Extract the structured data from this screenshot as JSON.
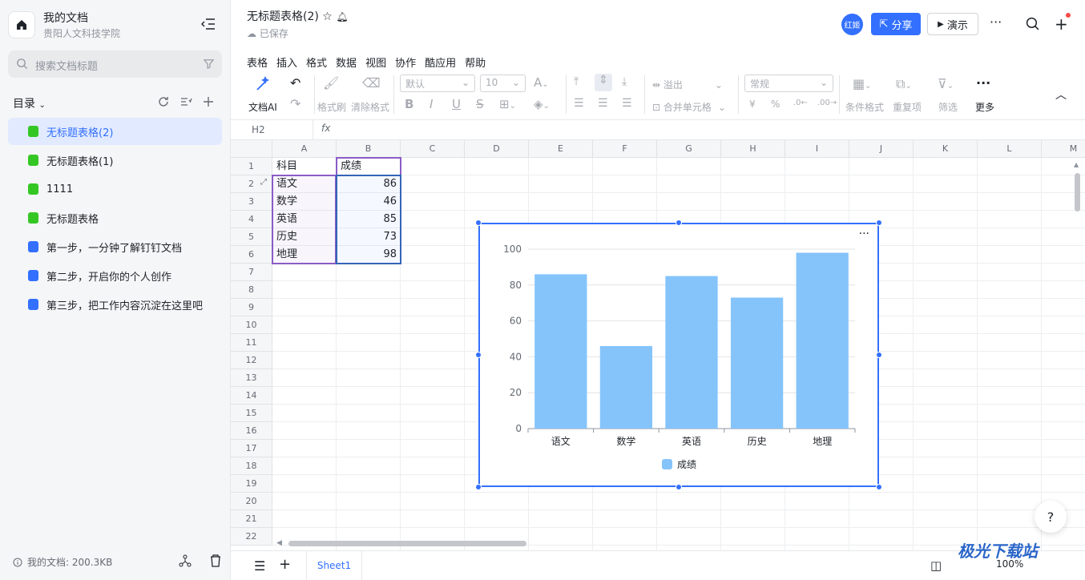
{
  "sidebar": {
    "workspace_name": "我的文档",
    "workspace_org": "贵阳人文科技学院",
    "search_placeholder": "搜索文档标题",
    "toc_label": "目录",
    "items": [
      {
        "label": "无标题表格(2)",
        "type": "sheet",
        "active": true
      },
      {
        "label": "无标题表格(1)",
        "type": "sheet",
        "active": false
      },
      {
        "label": "1111",
        "type": "sheet",
        "active": false
      },
      {
        "label": "无标题表格",
        "type": "sheet",
        "active": false
      },
      {
        "label": "第一步，一分钟了解钉钉文档",
        "type": "doc",
        "active": false
      },
      {
        "label": "第二步，开启你的个人创作",
        "type": "doc",
        "active": false
      },
      {
        "label": "第三步，把工作内容沉淀在这里吧",
        "type": "doc",
        "active": false
      }
    ],
    "footer": "我的文档: 200.3KB"
  },
  "header": {
    "title": "无标题表格(2)",
    "saved": "已保存",
    "avatar": "红姬",
    "share": "分享",
    "present": "演示"
  },
  "menu": [
    "表格",
    "插入",
    "格式",
    "数据",
    "视图",
    "协作",
    "酷应用",
    "帮助"
  ],
  "toolbar": {
    "ai": "文档AI",
    "format_painter": "格式刷",
    "clear_format": "清除格式",
    "font": "默认",
    "size": "10",
    "overflow": "溢出",
    "merge": "合并单元格",
    "numfmt": "常规",
    "currency": "¥",
    "percent": "%",
    "cond_format": "条件格式",
    "dup": "重复项",
    "filter": "筛选",
    "more": "更多"
  },
  "formula_bar": {
    "cell_ref": "H2",
    "fx": "fx"
  },
  "columns": [
    "A",
    "B",
    "C",
    "D",
    "E",
    "F",
    "G",
    "H",
    "I",
    "J",
    "K",
    "L",
    "M"
  ],
  "rows": [
    "1",
    "2",
    "3",
    "4",
    "5",
    "6",
    "7",
    "8",
    "9",
    "10",
    "11",
    "12",
    "13",
    "14",
    "15",
    "16",
    "17",
    "18",
    "19",
    "20",
    "21",
    "22"
  ],
  "cells": {
    "A1": "科目",
    "B1": "成绩",
    "A2": "语文",
    "B2": "86",
    "A3": "数学",
    "B3": "46",
    "A4": "英语",
    "B4": "85",
    "A5": "历史",
    "B5": "73",
    "A6": "地理",
    "B6": "98"
  },
  "chart_data": {
    "type": "bar",
    "categories": [
      "语文",
      "数学",
      "英语",
      "历史",
      "地理"
    ],
    "series": [
      {
        "name": "成绩",
        "values": [
          86,
          46,
          85,
          73,
          98
        ],
        "color": "#85c4fb"
      }
    ],
    "ylim": [
      0,
      100
    ],
    "yticks": [
      "0",
      "20",
      "40",
      "60",
      "80",
      "100"
    ],
    "legend": "bottom",
    "grid": true
  },
  "sheet_tab": "Sheet1",
  "zoom": "100%",
  "watermark": "极光下载站",
  "colors": {
    "accent": "#3370ff",
    "bar": "#85c4fb"
  }
}
